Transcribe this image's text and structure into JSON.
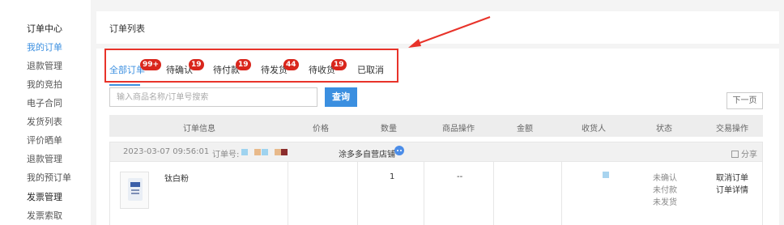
{
  "sidebar": {
    "items": [
      {
        "label": "订单中心"
      },
      {
        "label": "我的订单"
      },
      {
        "label": "退款管理"
      },
      {
        "label": "我的竞拍"
      },
      {
        "label": "电子合同"
      },
      {
        "label": "发货列表"
      },
      {
        "label": "评价晒单"
      },
      {
        "label": "退款管理"
      },
      {
        "label": "我的预订单"
      },
      {
        "label": "发票管理"
      },
      {
        "label": "发票索取"
      }
    ]
  },
  "header": {
    "title": "订单列表"
  },
  "tabs": [
    {
      "label": "全部订单",
      "badge": "99+"
    },
    {
      "label": "待确认",
      "badge": "19"
    },
    {
      "label": "待付款",
      "badge": "19"
    },
    {
      "label": "待发货",
      "badge": "44"
    },
    {
      "label": "待收货",
      "badge": "19"
    },
    {
      "label": "已取消",
      "badge": ""
    }
  ],
  "search": {
    "placeholder": "输入商品名称/订单号搜索",
    "button": "查询"
  },
  "pagination": {
    "next": "下一页"
  },
  "table": {
    "columns": [
      "订单信息",
      "价格",
      "数量",
      "商品操作",
      "金额",
      "收货人",
      "状态",
      "交易操作"
    ]
  },
  "order": {
    "date": "2023-03-07 09:56:01",
    "order_no_label": "订单号:",
    "shop": "涂多多自营店铺",
    "share": "分享",
    "product_name": "钛白粉",
    "quantity": "1",
    "product_ops": "--",
    "status": [
      "未确认",
      "未付款",
      "未发货"
    ],
    "actions": [
      "取消订单",
      "订单详情"
    ]
  },
  "colors": {
    "accent": "#3b8fe0",
    "badge": "#d9261c",
    "highlight": "#e8332a"
  }
}
